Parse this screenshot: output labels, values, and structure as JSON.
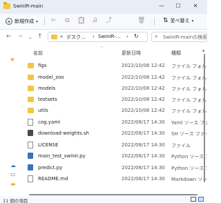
{
  "window": {
    "title": "SwinIR-main",
    "minimize": "—",
    "maximize": "☐",
    "close": "✕"
  },
  "toolbar": {
    "new_label": "新規作成",
    "sort_label": "並べ替え",
    "more_label": "•••"
  },
  "address": {
    "crumbs": [
      "«",
      "デスク...",
      "›",
      "SwinIR-...",
      "›"
    ],
    "search_placeholder": "SwinIR-mainの検索"
  },
  "columns": {
    "name": "名前",
    "date": "更新日時",
    "type": "種類"
  },
  "files": [
    {
      "name": "figs",
      "date": "2022/10/08 12:42",
      "type": "ファイル フォルダー",
      "icon": "folder-icon"
    },
    {
      "name": "model_zoo",
      "date": "2022/10/08 12:42",
      "type": "ファイル フォルダー",
      "icon": "folder-icon"
    },
    {
      "name": "models",
      "date": "2022/10/08 12:42",
      "type": "ファイル フォルダー",
      "icon": "folder-icon"
    },
    {
      "name": "testsets",
      "date": "2022/10/08 12:42",
      "type": "ファイル フォルダー",
      "icon": "folder-icon"
    },
    {
      "name": "utils",
      "date": "2022/10/08 12:42",
      "type": "ファイル フォルダー",
      "icon": "folder-icon"
    },
    {
      "name": "cog.yaml",
      "date": "2022/08/17 14:30",
      "type": "Yaml ソース ファイル",
      "icon": "file-icon"
    },
    {
      "name": "download-weights.sh",
      "date": "2022/08/17 14:30",
      "type": "SH ソース ファイル",
      "icon": "shell-file-icon"
    },
    {
      "name": "LICENSE",
      "date": "2022/08/17 14:30",
      "type": "ファイル",
      "icon": "file-icon"
    },
    {
      "name": "main_test_swinir.py",
      "date": "2022/08/17 14:30",
      "type": "Python ソース ファイ",
      "icon": "python-file-icon"
    },
    {
      "name": "predict.py",
      "date": "2022/08/17 14:30",
      "type": "Python ソース ファイ",
      "icon": "python-file-icon"
    },
    {
      "name": "README.md",
      "date": "2022/08/17 14:30",
      "type": "Markdown ソース ファ",
      "icon": "file-icon"
    }
  ],
  "status": {
    "item_count": "11 個の項目"
  },
  "colors": {
    "title_bar": "#e9eef6",
    "folder": "#f2c744",
    "accent": "#3a78c2"
  }
}
